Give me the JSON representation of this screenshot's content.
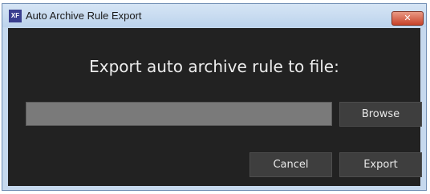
{
  "window": {
    "title": "Auto Archive Rule Export",
    "icon_label": "XF",
    "close_glyph": "✕"
  },
  "dialog": {
    "heading": "Export auto archive rule to file:",
    "path_value": "",
    "browse_label": "Browse",
    "cancel_label": "Cancel",
    "export_label": "Export"
  },
  "colors": {
    "dialog_background": "#222222",
    "titlebar": "#c6d9ee",
    "input_background": "#7a7a7a",
    "button_background": "#3e3e3e",
    "close_button": "#c8432a"
  }
}
